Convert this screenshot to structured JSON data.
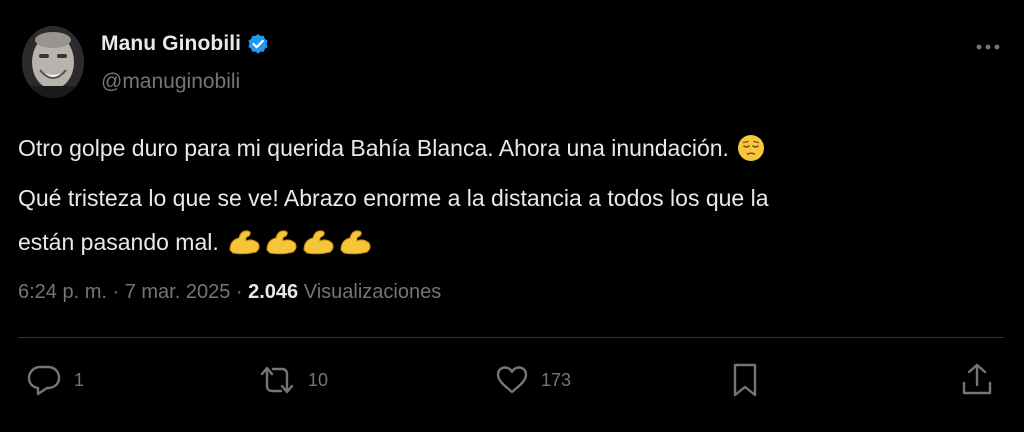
{
  "author": {
    "display_name": "Manu Ginobili",
    "handle": "@manuginobili",
    "verified": true
  },
  "tweet": {
    "lines": [
      "Otro golpe duro para mi querida Bahía Blanca. Ahora una inundación.",
      "Qué tristeza lo que se ve! Abrazo enorme a la distancia a todos los que la",
      "están pasando mal."
    ],
    "emojis": [
      "pensive-face",
      "flexed-biceps",
      "flexed-biceps",
      "flexed-biceps",
      "flexed-biceps"
    ]
  },
  "meta": {
    "time": "6:24 p. m.",
    "separator1": " · ",
    "date": "7 mar. 2025",
    "separator2": " · ",
    "views_count": "2.046",
    "views_label": "Visualizaciones"
  },
  "actions": {
    "replies": "1",
    "reposts": "10",
    "likes": "173"
  },
  "colors": {
    "background": "#000000",
    "text": "#e7e9ea",
    "secondary": "#71767b",
    "verified": "#1d9bf0",
    "divider": "#2f3336"
  }
}
